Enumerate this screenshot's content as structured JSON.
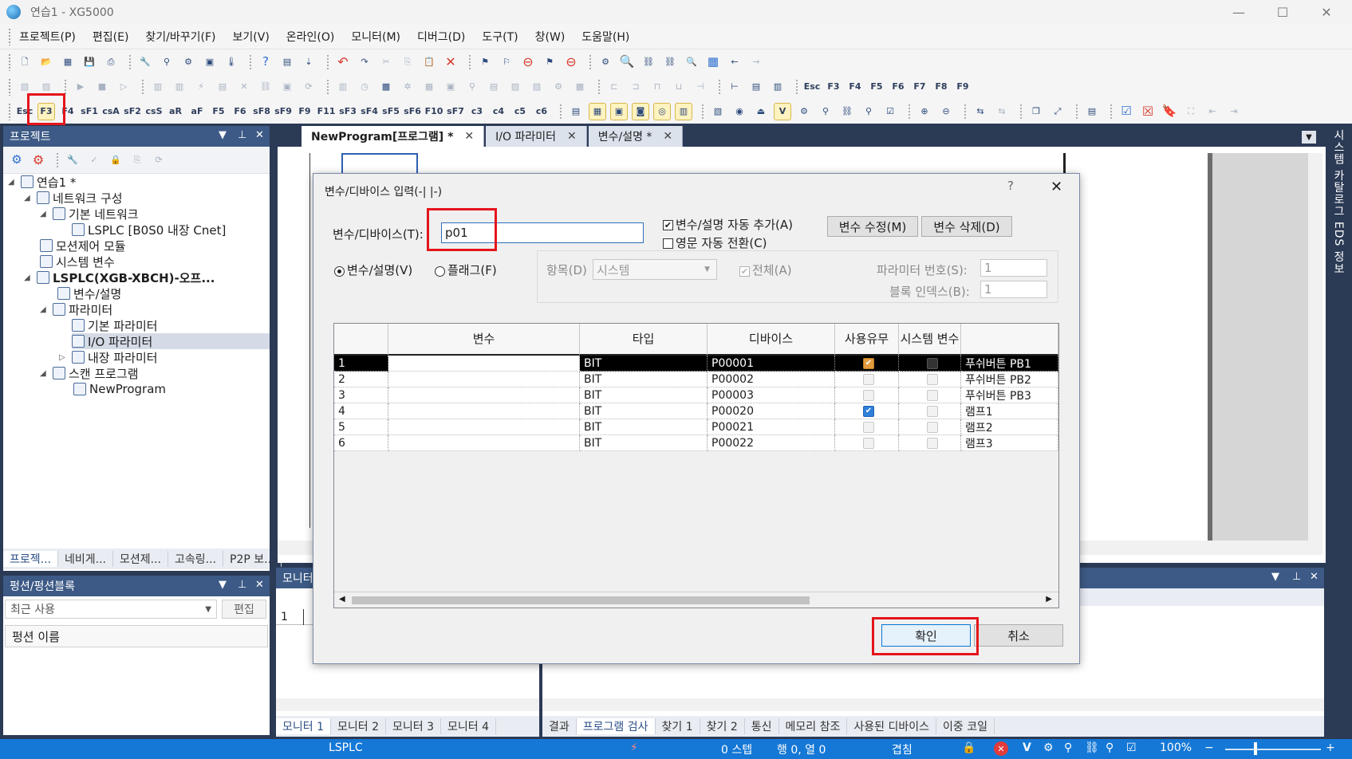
{
  "window": {
    "title": "연습1 - XG5000",
    "min": "—",
    "max": "☐",
    "close": "✕"
  },
  "menu": [
    "프로젝트(P)",
    "편집(E)",
    "찾기/바꾸기(F)",
    "보기(V)",
    "온라인(O)",
    "모니터(M)",
    "디버그(D)",
    "도구(T)",
    "창(W)",
    "도움말(H)"
  ],
  "toolbar3_keys": [
    "Esc",
    "F3",
    "F4",
    "sF1",
    "csA",
    "sF2",
    "csS",
    "aR",
    "aF",
    "F5",
    "F6",
    "sF8",
    "sF9",
    "F9",
    "F11",
    "sF3",
    "sF4",
    "sF5",
    "sF6",
    "F10",
    "sF7",
    "c3",
    "c4",
    "c5",
    "c6"
  ],
  "toolbar2_keys": [
    "Esc",
    "F3",
    "F4",
    "F5",
    "F6",
    "F7",
    "F8",
    "F9"
  ],
  "project_panel": {
    "title": "프로젝트",
    "tree": [
      {
        "label": "연습1 *"
      },
      {
        "label": "네트워크 구성"
      },
      {
        "label": "기본 네트워크"
      },
      {
        "label": "LSPLC [B0S0 내장 Cnet]"
      },
      {
        "label": "모션제어 모듈"
      },
      {
        "label": "시스템 변수"
      },
      {
        "label": "LSPLC(XGB-XBCH)-오프..."
      },
      {
        "label": "변수/설명"
      },
      {
        "label": "파라미터"
      },
      {
        "label": "기본 파라미터"
      },
      {
        "label": "I/O 파라미터"
      },
      {
        "label": "내장 파라미터"
      },
      {
        "label": "스캔 프로그램"
      },
      {
        "label": "NewProgram"
      }
    ],
    "bottom_tabs": [
      "프로젝...",
      "네비게...",
      "모션제...",
      "고속링...",
      "P2P 보..."
    ]
  },
  "fb_panel": {
    "title": "펑션/펑션블록",
    "combo": "최근 사용",
    "edit_button": "편집",
    "list_header": "펑션 이름"
  },
  "doc_tabs": [
    {
      "label": "NewProgram[프로그램] *",
      "close": "✕"
    },
    {
      "label": "I/O 파라미터",
      "close": "✕"
    },
    {
      "label": "변수/설명 *",
      "close": "✕"
    }
  ],
  "right_sidebar": "시스템 카탈로그 EDS 정보",
  "monitor_panel": {
    "title": "모니터",
    "row1": "1",
    "tabs": [
      "모니터 1",
      "모니터 2",
      "모니터 3",
      "모니터 4"
    ]
  },
  "result_tabs": [
    "결과",
    "프로그램 검사",
    "찾기 1",
    "찾기 2",
    "통신",
    "메모리 참조",
    "사용된 디바이스",
    "이중 코일"
  ],
  "dialog": {
    "title": "변수/디바이스 입력(-| |-)",
    "help": "?",
    "close": "✕",
    "input_label": "변수/디바이스(T):",
    "input_value": "p01",
    "auto_add_label": "변수/설명 자동 추가(A)",
    "auto_convert_label": "영문 자동 전환(C)",
    "edit_var_button": "변수 수정(M)",
    "delete_var_button": "변수 삭제(D)",
    "radio_var_label": "변수/설명(V)",
    "radio_flag_label": "플래그(F)",
    "item_label": "항목(D)",
    "item_value": "시스템",
    "all_label": "전체(A)",
    "param_no_label": "파라미터 번호(S):",
    "param_no_value": "1",
    "block_index_label": "블록 인덱스(B):",
    "block_index_value": "1",
    "columns": [
      "변수",
      "타입",
      "디바이스",
      "사용유무",
      "시스템 변수",
      ""
    ],
    "rows": [
      {
        "no": "1",
        "var": "",
        "type": "BIT",
        "device": "P00001",
        "used": "checked",
        "sys": "",
        "comment": "푸쉬버튼 PB1"
      },
      {
        "no": "2",
        "var": "",
        "type": "BIT",
        "device": "P00002",
        "used": "",
        "sys": "",
        "comment": "푸쉬버튼 PB2"
      },
      {
        "no": "3",
        "var": "",
        "type": "BIT",
        "device": "P00003",
        "used": "",
        "sys": "",
        "comment": "푸쉬버튼 PB3"
      },
      {
        "no": "4",
        "var": "",
        "type": "BIT",
        "device": "P00020",
        "used": "checked",
        "sys": "",
        "comment": "램프1"
      },
      {
        "no": "5",
        "var": "",
        "type": "BIT",
        "device": "P00021",
        "used": "",
        "sys": "",
        "comment": "램프2"
      },
      {
        "no": "6",
        "var": "",
        "type": "BIT",
        "device": "P00022",
        "used": "",
        "sys": "",
        "comment": "램프3"
      }
    ],
    "ok_button": "확인",
    "cancel_button": "취소"
  },
  "statusbar": {
    "plc": "LSPLC",
    "step": "0 스텝",
    "position": "행 0, 열 0",
    "mode": "겹침",
    "zoom": "100%",
    "zoom_minus": "−",
    "zoom_plus": "+"
  },
  "colors": {
    "titlebar": "#f3f3f3",
    "panel_header": "#3d5a86",
    "statusbar": "#1578d6",
    "highlight_box": "#e5141b",
    "check_orange": "#e39b3e",
    "check_blue": "#2f7ed8"
  }
}
